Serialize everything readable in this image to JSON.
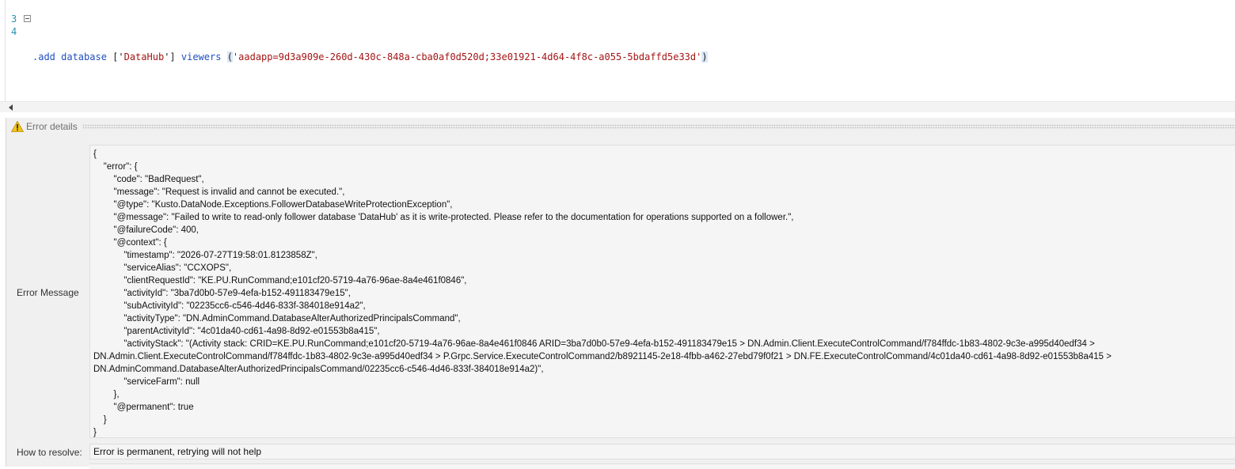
{
  "editor": {
    "lines": [
      {
        "number": "3"
      },
      {
        "number": "4",
        "tokens": {
          "cmd": ".add database",
          "space1": " ",
          "bracket_open": "['",
          "db": "DataHub",
          "bracket_close": "']",
          "space2": " ",
          "kw": "viewers",
          "space3": " ",
          "paren_open": "(",
          "str": "'aadapp=9d3a909e-260d-430c-848a-cba0af0d520d;33e01921-4d64-4f8c-a055-5bdaffd5e33d'",
          "paren_close": ")"
        }
      }
    ]
  },
  "panel": {
    "title": "Error details",
    "icon": "warning-icon",
    "error_message_label": "Error Message",
    "how_to_resolve_label": "How to resolve:",
    "how_to_resolve_value": "Error is permanent, retrying will not help",
    "error_json_lines": [
      "{",
      "    \"error\": {",
      "        \"code\": \"BadRequest\",",
      "        \"message\": \"Request is invalid and cannot be executed.\",",
      "        \"@type\": \"Kusto.DataNode.Exceptions.FollowerDatabaseWriteProtectionException\",",
      "        \"@message\": \"Failed to write to read-only follower database 'DataHub' as it is write-protected. Please refer to the documentation for operations supported on a follower.\",",
      "        \"@failureCode\": 400,",
      "        \"@context\": {",
      "            \"timestamp\": \"2026-07-27T19:58:01.8123858Z\",",
      "            \"serviceAlias\": \"CCXOPS\",",
      "            \"clientRequestId\": \"KE.PU.RunCommand;e101cf20-5719-4a76-96ae-8a4e461f0846\",",
      "            \"activityId\": \"3ba7d0b0-57e9-4efa-b152-491183479e15\",",
      "            \"subActivityId\": \"02235cc6-c546-4d46-833f-384018e914a2\",",
      "            \"activityType\": \"DN.AdminCommand.DatabaseAlterAuthorizedPrincipalsCommand\",",
      "            \"parentActivityId\": \"4c01da40-cd61-4a98-8d92-e01553b8a415\",",
      "            \"activityStack\": \"(Activity stack: CRID=KE.PU.RunCommand;e101cf20-5719-4a76-96ae-8a4e461f0846 ARID=3ba7d0b0-57e9-4efa-b152-491183479e15 > DN.Admin.Client.ExecuteControlCommand/f784ffdc-1b83-4802-9c3e-a995d40edf34 >",
      "DN.Admin.Client.ExecuteControlCommand/f784ffdc-1b83-4802-9c3e-a995d40edf34 > P.Grpc.Service.ExecuteControlCommand2/b8921145-2e18-4fbb-a462-27ebd79f0f21 > DN.FE.ExecuteControlCommand/4c01da40-cd61-4a98-8d92-e01553b8a415 >",
      "DN.AdminCommand.DatabaseAlterAuthorizedPrincipalsCommand/02235cc6-c546-4d46-833f-384018e914a2)\",",
      "            \"serviceFarm\": null",
      "        },",
      "        \"@permanent\": true",
      "    }",
      "}"
    ]
  }
}
